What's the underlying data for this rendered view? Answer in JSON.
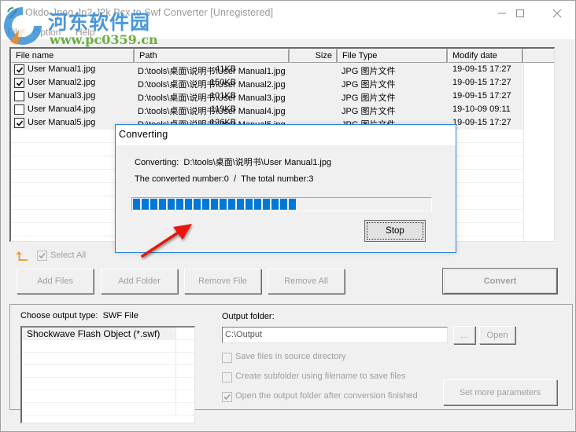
{
  "window": {
    "title": "Okdo Jpeg Jp2 J2k Pcx to Swf Converter [Unregistered]",
    "controls": {
      "minimize": "minimize-icon",
      "maximize": "maximize-icon",
      "close": "close-icon"
    }
  },
  "watermark": {
    "brand": "河东软件园",
    "url": "www.pc0359.cn"
  },
  "menu": [
    "File",
    "Option",
    "Help"
  ],
  "file_list": {
    "columns": [
      "File name",
      "Path",
      "Size",
      "File Type",
      "Modify date"
    ],
    "rows": [
      {
        "checked": true,
        "name": "User Manual1.jpg",
        "path": "D:\\tools\\桌面\\说明书\\User Manual1.jpg",
        "size": "41KB",
        "type": "JPG 图片文件",
        "date": "19-09-15 17:27"
      },
      {
        "checked": true,
        "name": "User Manual2.jpg",
        "path": "D:\\tools\\桌面\\说明书\\User Manual2.jpg",
        "size": "150KB",
        "type": "JPG 图片文件",
        "date": "19-09-15 17:27"
      },
      {
        "checked": false,
        "name": "User Manual3.jpg",
        "path": "D:\\tools\\桌面\\说明书\\User Manual3.jpg",
        "size": "101KB",
        "type": "JPG 图片文件",
        "date": "19-09-15 17:27"
      },
      {
        "checked": false,
        "name": "User Manual4.jpg",
        "path": "D:\\tools\\桌面\\说明书\\User Manual4.jpg",
        "size": "119KB",
        "type": "JPG 图片文件",
        "date": "19-10-09 09:11"
      },
      {
        "checked": true,
        "name": "User Manual5.jpg",
        "path": "D:\\tools\\桌面\\说明书\\User Manual5.jpg",
        "size": "126KB",
        "type": "JPG 图片文件",
        "date": "19-09-15 17:27"
      }
    ]
  },
  "select_all": {
    "label": "Select All",
    "checked": true,
    "icon": "up-folder-icon"
  },
  "buttons": {
    "add_files": "Add Files",
    "add_folder": "Add Folder",
    "remove_file": "Remove File",
    "remove_all": "Remove All",
    "convert": "Convert",
    "browse": "...",
    "open": "Open",
    "set_more_parameters": "Set more parameters"
  },
  "output": {
    "type_label": "Choose output type:",
    "type_value": "SWF File",
    "types": [
      "Shockwave Flash Object (*.swf)"
    ],
    "folder_label": "Output folder:",
    "folder_value": "C:\\Output",
    "options": [
      {
        "label": "Save files in source directory",
        "checked": false
      },
      {
        "label": "Create subfolder using filename to save files",
        "checked": false
      },
      {
        "label": "Open the output folder after conversion finished",
        "checked": true
      }
    ]
  },
  "dialog": {
    "title": "Converting",
    "converting_label": "Converting:",
    "converting_file": "D:\\tools\\桌面\\说明书\\User Manual1.jpg",
    "converted_label": "The converted number:",
    "converted_value": "0",
    "separator": "/",
    "total_label": "The total number:",
    "total_value": "3",
    "progress_percent": 55,
    "progress_color": "#0078d7",
    "stop_label": "Stop"
  },
  "colors": {
    "accent": "#0078d7",
    "dialog_border": "#2b84d4",
    "disabled_text": "#a0a0a0",
    "annotation_arrow": "#e8160c"
  }
}
